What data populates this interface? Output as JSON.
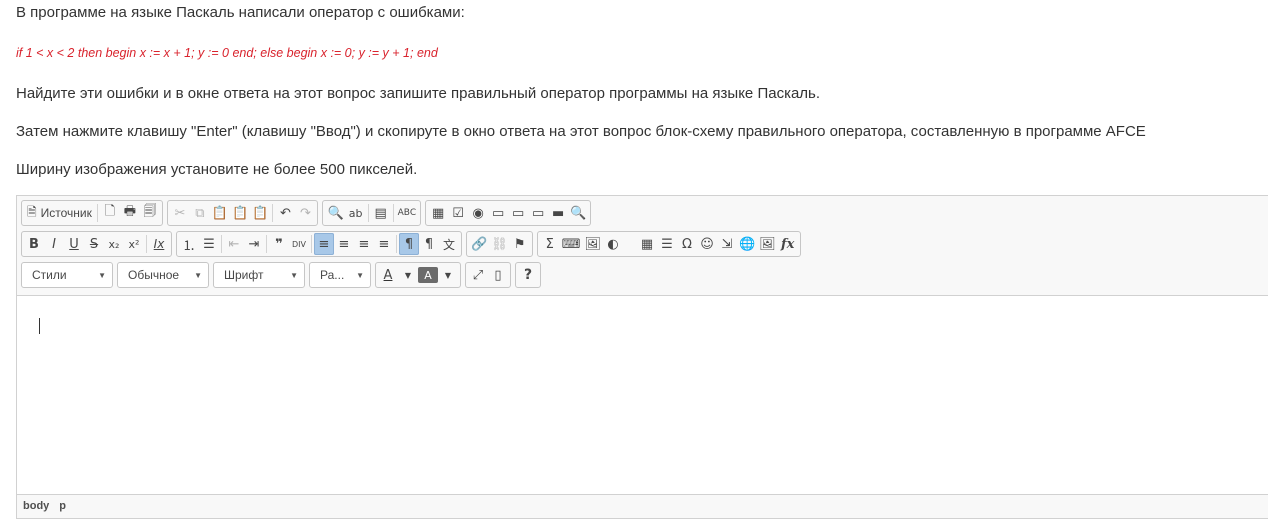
{
  "question": {
    "line1": "В программе на языке Паскаль написали оператор с ошибками:",
    "code": "if 1 < x < 2 then begin x := x + 1; y := 0 end; else begin x := 0; y := y + 1; end",
    "line2": "Найдите эти ошибки и в окне ответа на этот вопрос запишите правильный оператор программы на языке Паскаль.",
    "line3": "Затем нажмите клавишу \"Enter\" (клавишу \"Ввод\") и скопируте в окно ответа на этот вопрос блок-схему правильного оператора, составленную в программе AFCE",
    "line4": "Ширину изображения установите не более 500 пикселей."
  },
  "toolbar": {
    "source_label": "Источник",
    "styles_label": "Стили",
    "format_label": "Обычное",
    "font_label": "Шрифт",
    "size_label": "Ра...",
    "glyphs": {
      "source": "🗎",
      "newpage": "🗋",
      "print": "🖶",
      "templates": "🗐",
      "cut": "✂",
      "copy": "⧉",
      "paste": "📋",
      "paste_text": "📋",
      "paste_word": "📋",
      "undo": "↶",
      "redo": "↷",
      "find": "🔍",
      "replace": "ab",
      "select_all": "▤",
      "spell": "ABC",
      "form": "▦",
      "checkbox": "☑",
      "radio": "◉",
      "textfield": "▭",
      "textarea": "▭",
      "select": "▭",
      "button": "▬",
      "imagebutton": "🔍",
      "bold": "B",
      "italic": "I",
      "underline": "U",
      "strike": "S",
      "subscript": "x₂",
      "superscript": "x²",
      "remove_format": "Ix",
      "numbered_list": "⒈",
      "bulleted_list": "☰",
      "outdent": "⇤",
      "indent": "⇥",
      "blockquote": "❞",
      "div": "DIV",
      "align_left": "≡",
      "align_center": "≡",
      "align_right": "≡",
      "justify": "≡",
      "ltr": "¶",
      "rtl": "¶",
      "language": "文",
      "link": "🔗",
      "unlink": "⛓",
      "anchor": "⚑",
      "sum": "Σ",
      "code_block": "⌨",
      "image": "🖼",
      "flash": "◐",
      "table": "▦",
      "hr": "☰",
      "special_char": "Ω",
      "smiley": "☺",
      "page_break": "⇲",
      "iframe": "🌐",
      "image2": "🖼",
      "formula": "fx",
      "text_color": "A",
      "bg_color": "A",
      "maximize": "⤢",
      "show_blocks": "▯",
      "help": "?"
    }
  },
  "path": {
    "body": "body",
    "p": "p"
  }
}
